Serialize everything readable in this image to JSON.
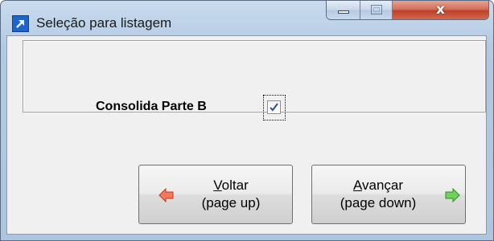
{
  "window": {
    "title": "Seleção para listagem",
    "controls": {
      "minimize": "minimize",
      "maximize": "maximize",
      "close": "x"
    }
  },
  "options": {
    "consolida_label": "Consolida Parte B",
    "consolida_checked": true
  },
  "buttons": {
    "back_label_first": "V",
    "back_label_rest": "oltar",
    "back_shortcut": "(page up)",
    "next_label_first": "A",
    "next_label_rest": "vançar",
    "next_shortcut": "(page down)"
  },
  "colors": {
    "back_arrow": "#e8553a",
    "next_arrow": "#4fbf3a",
    "checkmark": "#2a4ea8"
  },
  "icons": [
    "app-arrow-icon",
    "minimize-icon",
    "maximize-icon",
    "close-icon",
    "checkmark-icon",
    "left-arrow-icon",
    "right-arrow-icon"
  ]
}
